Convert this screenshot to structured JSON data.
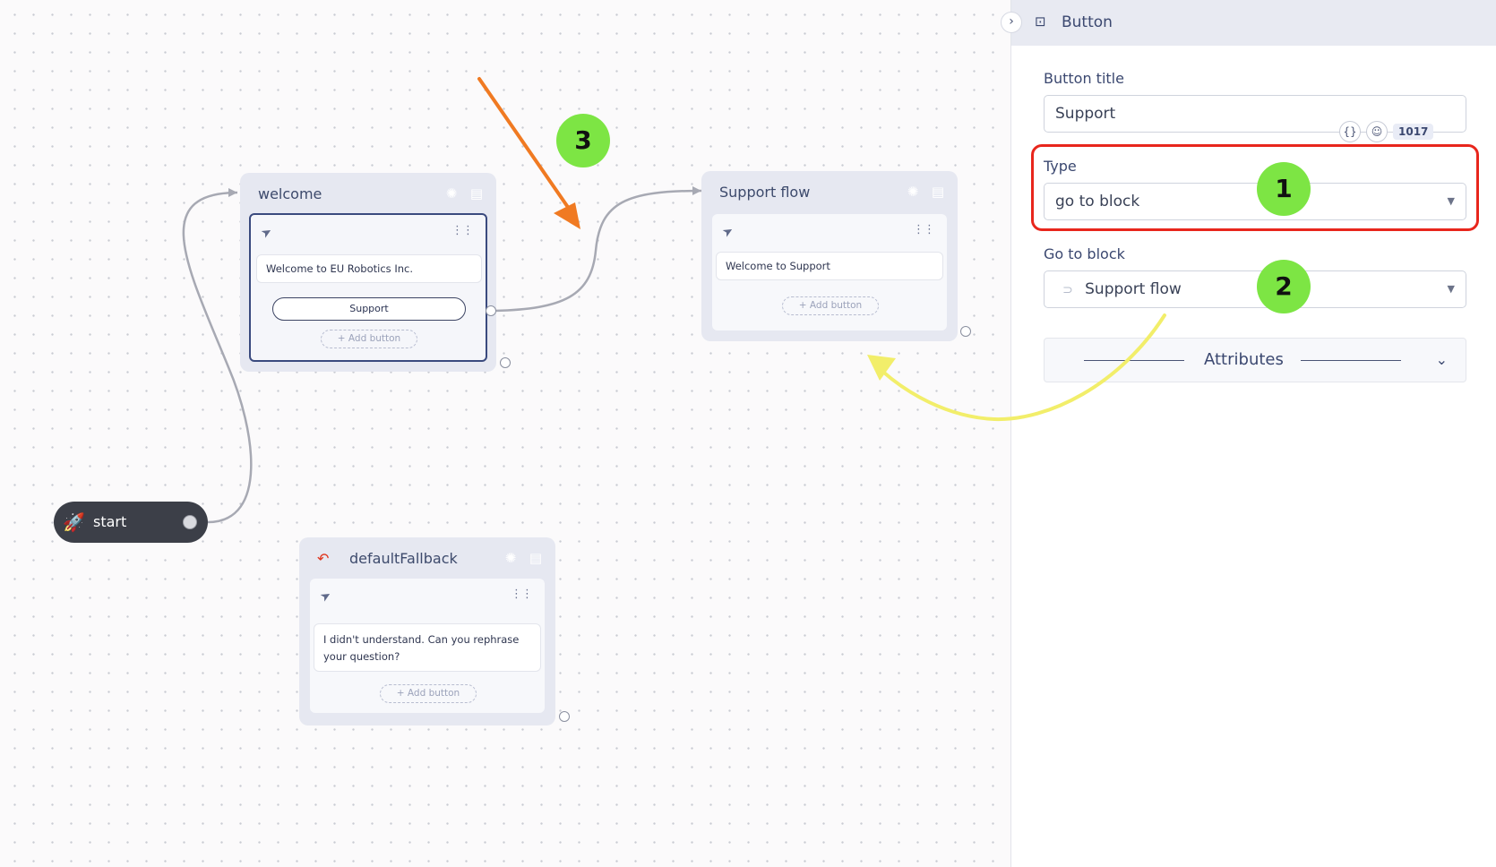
{
  "canvas": {
    "start": {
      "label": "start"
    },
    "welcome": {
      "title": "welcome",
      "message": "Welcome to EU Robotics Inc.",
      "button": "Support",
      "add_button": "+ Add button"
    },
    "support_flow": {
      "title": "Support flow",
      "message": "Welcome to Support",
      "add_button": "+ Add button"
    },
    "default_fallback": {
      "title": "defaultFallback",
      "message": "I didn't understand. Can you rephrase your question?",
      "add_button": "+ Add button"
    }
  },
  "panel": {
    "title": "Button",
    "button_title_label": "Button title",
    "button_title_value": "Support",
    "char_counter": "1017",
    "type_label": "Type",
    "type_value": "go to block",
    "go_to_block_label": "Go to block",
    "go_to_block_value": "Support flow",
    "attributes_label": "Attributes"
  },
  "annotations": {
    "callout_1": "1",
    "callout_2": "2",
    "callout_3": "3",
    "highlight_color": "#e8261c",
    "orange_arrow_color": "#f07a22",
    "yellow_arrow_color": "#f2ee6a",
    "callout_color": "#7de544"
  },
  "icons": {
    "block_header": [
      "ai-brain-icon",
      "notes-icon"
    ],
    "message": "send-icon",
    "drag": "drag-handle-icon",
    "start": "rocket-icon",
    "fallback": "undo-icon",
    "panel_title": "button-icon",
    "variable": "braces-icon",
    "emoji": "emoji-icon"
  }
}
